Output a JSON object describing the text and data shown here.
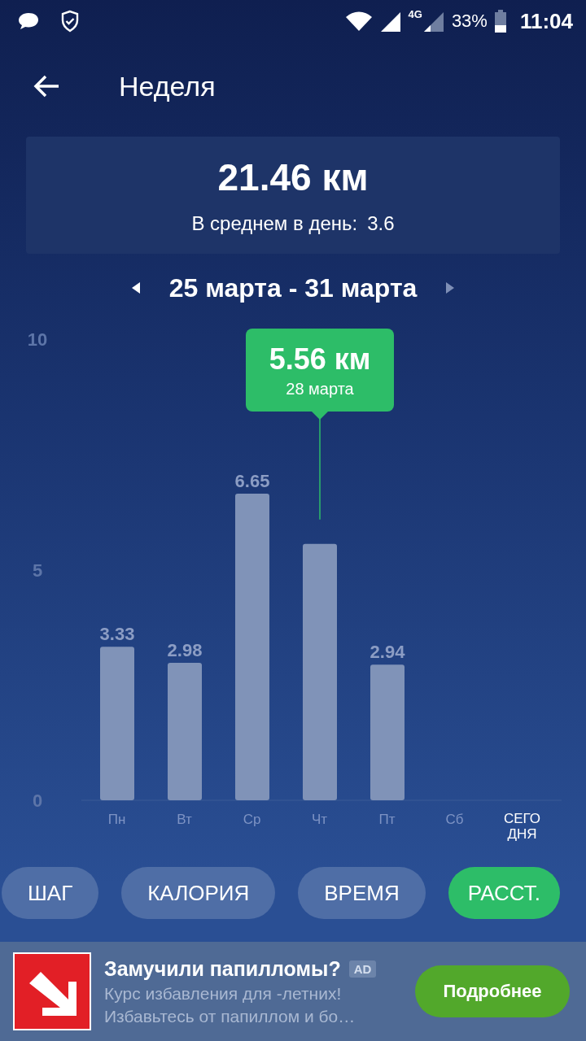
{
  "status_bar": {
    "network_label": "4G",
    "battery": "33%",
    "time": "11:04"
  },
  "header": {
    "title": "Неделя"
  },
  "summary": {
    "total": "21.46 км",
    "average_label": "В среднем в день:",
    "average_value": "3.6"
  },
  "period": {
    "label": "25 марта - 31 марта"
  },
  "chart": {
    "chart_data": {
      "type": "bar",
      "categories": [
        "Пн",
        "Вт",
        "Ср",
        "Чт",
        "Пт",
        "Сб",
        "СЕГОДНЯ"
      ],
      "series": [
        {
          "color": "#8093b8",
          "values": [
            3.33,
            2.98,
            6.65,
            5.56,
            2.94,
            null,
            null
          ]
        }
      ],
      "ylim": [
        0,
        10
      ],
      "yticks": [
        0,
        5,
        10
      ],
      "value_labels": [
        "3.33",
        "2.98",
        "6.65",
        null,
        "2.94",
        null,
        null
      ],
      "annotations": [
        "5.56 км",
        "28 марта"
      ]
    }
  },
  "metric_tabs": [
    {
      "label": "ШАГ",
      "selected": false
    },
    {
      "label": "КАЛОРИЯ",
      "selected": false
    },
    {
      "label": "ВРЕМЯ",
      "selected": false
    },
    {
      "label": "РАССТ.",
      "selected": true
    }
  ],
  "ad": {
    "title": "Замучили папилломы?",
    "badge": "AD",
    "line_1": "Курс избавления для -летних!",
    "line_2": "Избавьтесь от папиллом и бо…",
    "button": "Подробнее"
  }
}
